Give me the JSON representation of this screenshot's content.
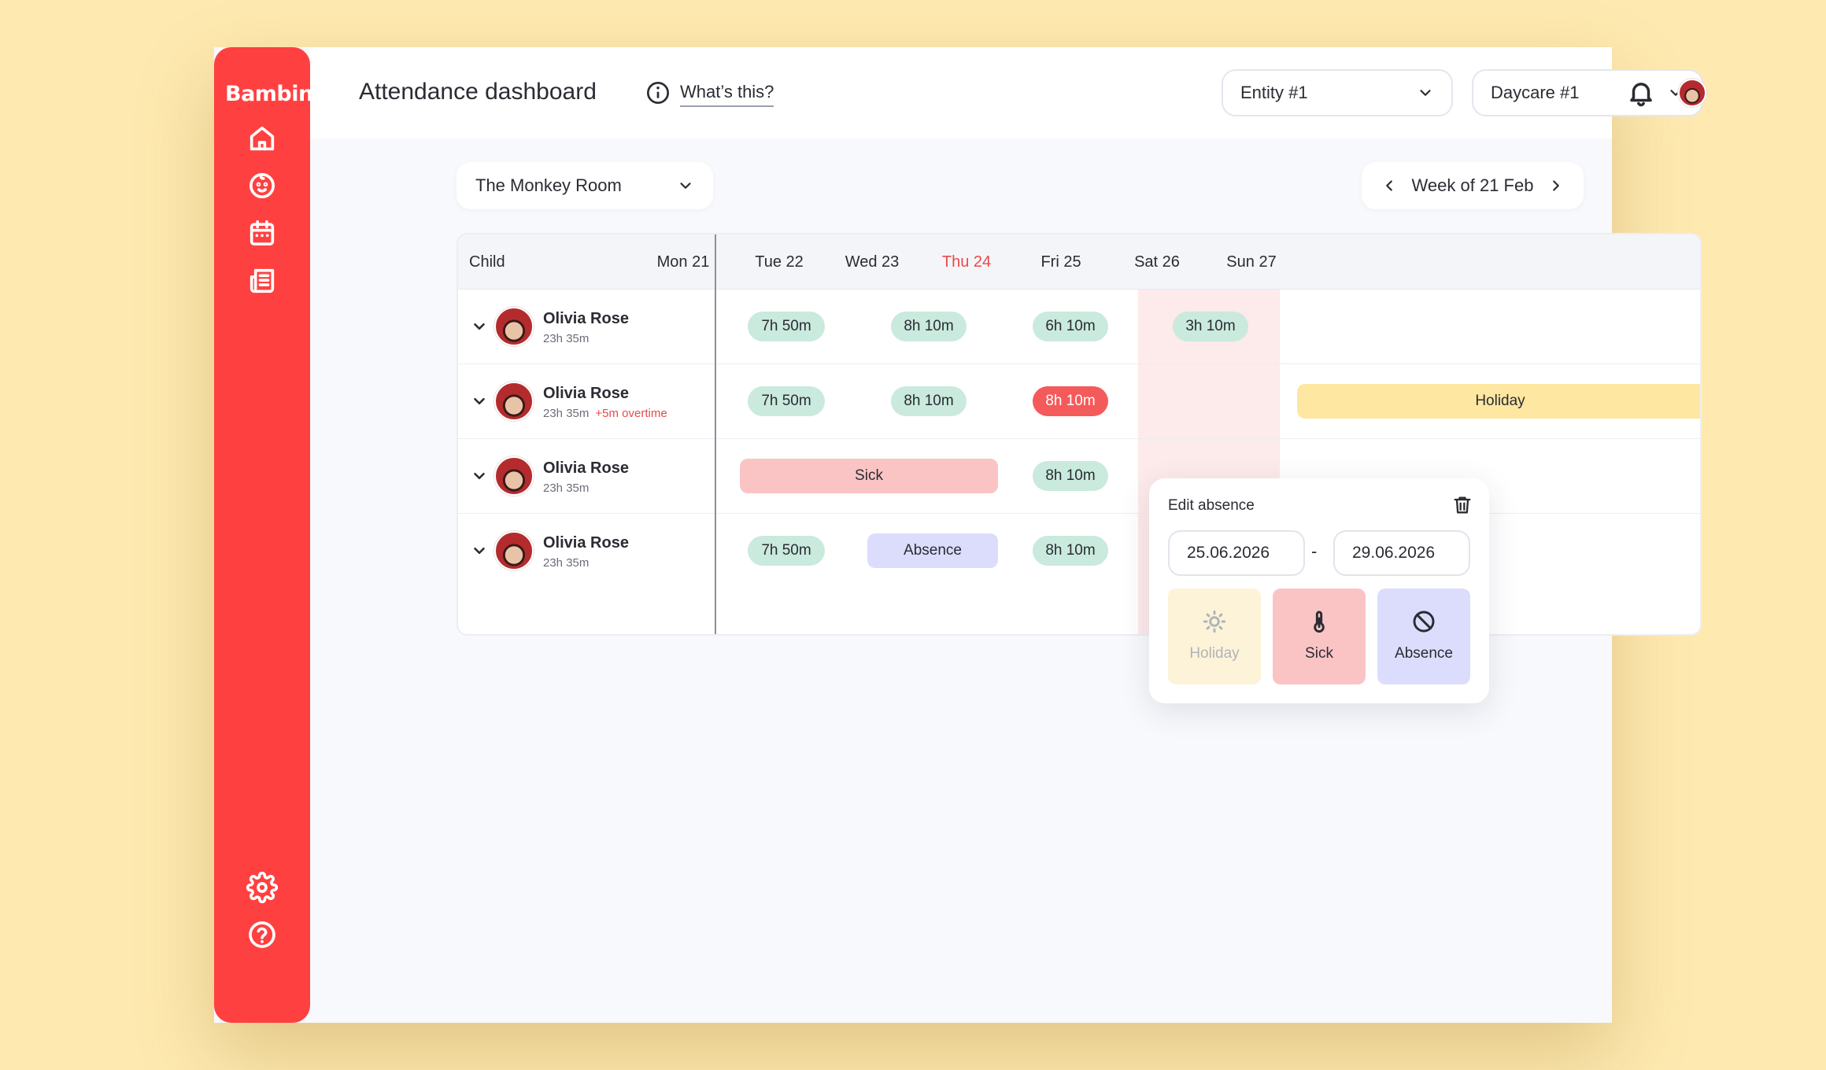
{
  "app": {
    "logo": "Bambin"
  },
  "sidebar": {
    "items": [
      {
        "name": "home",
        "icon": "home-icon"
      },
      {
        "name": "children",
        "icon": "baby-face-icon"
      },
      {
        "name": "calendar",
        "icon": "calendar-icon"
      },
      {
        "name": "reports",
        "icon": "newspaper-icon"
      },
      {
        "name": "settings",
        "icon": "gear-icon"
      },
      {
        "name": "help",
        "icon": "help-circle-icon"
      }
    ]
  },
  "header": {
    "title": "Attendance dashboard",
    "whats_this": "What’s this?",
    "entity_select": "Entity #1",
    "daycare_select": "Daycare #1"
  },
  "toolbar": {
    "room_select": "The Monkey Room",
    "week_label": "Week of 21 Feb"
  },
  "table": {
    "child_header": "Child",
    "days": [
      "Mon 21",
      "Tue 22",
      "Wed 23",
      "Thu 24",
      "Fri 25",
      "Sat 26",
      "Sun 27"
    ],
    "today_index": 3,
    "rows": [
      {
        "name": "Olivia Rose",
        "hours": "23h 35m",
        "overtime": "",
        "mon": "7h 50m",
        "tue": "8h 10m",
        "wed": "6h 10m",
        "thu": "3h 10m"
      },
      {
        "name": "Olivia Rose",
        "hours": "23h 35m",
        "overtime": "+5m overtime",
        "mon": "7h 50m",
        "tue": "8h 10m",
        "wed": "8h 10m",
        "holiday": "Holiday"
      },
      {
        "name": "Olivia Rose",
        "hours": "23h 35m",
        "overtime": "",
        "sick": "Sick",
        "wed": "8h 10m"
      },
      {
        "name": "Olivia Rose",
        "hours": "23h 35m",
        "overtime": "",
        "mon": "7h 50m",
        "absence": "Absence",
        "wed": "8h 10m"
      }
    ]
  },
  "popup": {
    "title": "Edit absence",
    "date_from": "25.06.2026",
    "separator": "-",
    "date_to": "29.06.2026",
    "types": [
      {
        "label": "Holiday",
        "icon": "sun-icon"
      },
      {
        "label": "Sick",
        "icon": "thermometer-icon"
      },
      {
        "label": "Absence",
        "icon": "ban-icon"
      }
    ]
  },
  "colors": {
    "background": "#fee9b0",
    "sidebar": "#ff4040",
    "today": "#e94a4a",
    "time_pill": "#c9eadd",
    "overtime_pill": "#f55a5a",
    "holiday": "#fde7a1",
    "sick": "#fbc4c4",
    "absence": "#dcddfd"
  }
}
